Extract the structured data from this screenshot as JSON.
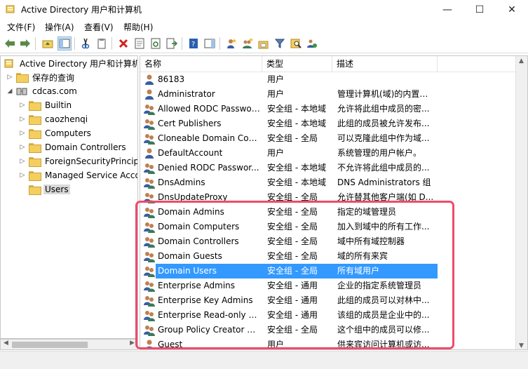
{
  "window": {
    "title": "Active Directory 用户和计算机",
    "minimize": "—",
    "maximize": "☐",
    "close": "✕"
  },
  "menu": [
    "文件(F)",
    "操作(A)",
    "查看(V)",
    "帮助(H)"
  ],
  "tree": {
    "root": "Active Directory 用户和计算机",
    "saved_queries": "保存的查询",
    "domain": "cdcas.com",
    "children": [
      "Builtin",
      "caozhenqi",
      "Computers",
      "Domain Controllers",
      "ForeignSecurityPrincipals",
      "Managed Service Accounts",
      "Users"
    ]
  },
  "list": {
    "columns": [
      "名称",
      "类型",
      "描述"
    ],
    "rows": [
      {
        "name": "86183",
        "type": "用户",
        "desc": "",
        "icon": "user"
      },
      {
        "name": "Administrator",
        "type": "用户",
        "desc": "管理计算机(域)的内置帐...",
        "icon": "user"
      },
      {
        "name": "Allowed RODC Passwor...",
        "type": "安全组 - 本地域",
        "desc": "允许将此组中成员的密...",
        "icon": "group"
      },
      {
        "name": "Cert Publishers",
        "type": "安全组 - 本地域",
        "desc": "此组的成员被允许发布...",
        "icon": "group"
      },
      {
        "name": "Cloneable Domain Cont...",
        "type": "安全组 - 全局",
        "desc": "可以克隆此组中作为域...",
        "icon": "group"
      },
      {
        "name": "DefaultAccount",
        "type": "用户",
        "desc": "系统管理的用户帐户。",
        "icon": "user"
      },
      {
        "name": "Denied RODC Passwor...",
        "type": "安全组 - 本地域",
        "desc": "不允许将此组中成员的...",
        "icon": "group"
      },
      {
        "name": "DnsAdmins",
        "type": "安全组 - 本地域",
        "desc": "DNS Administrators 组",
        "icon": "group"
      },
      {
        "name": "DnsUpdateProxy",
        "type": "安全组 - 全局",
        "desc": "允许替其他客户端(如 D...",
        "icon": "group"
      },
      {
        "name": "Domain Admins",
        "type": "安全组 - 全局",
        "desc": "指定的域管理员",
        "icon": "group"
      },
      {
        "name": "Domain Computers",
        "type": "安全组 - 全局",
        "desc": "加入到域中的所有工作...",
        "icon": "group"
      },
      {
        "name": "Domain Controllers",
        "type": "安全组 - 全局",
        "desc": "域中所有域控制器",
        "icon": "group"
      },
      {
        "name": "Domain Guests",
        "type": "安全组 - 全局",
        "desc": "域的所有来宾",
        "icon": "group"
      },
      {
        "name": "Domain Users",
        "type": "安全组 - 全局",
        "desc": "所有域用户",
        "icon": "group",
        "selected": true
      },
      {
        "name": "Enterprise Admins",
        "type": "安全组 - 通用",
        "desc": "企业的指定系统管理员",
        "icon": "group"
      },
      {
        "name": "Enterprise Key Admins",
        "type": "安全组 - 通用",
        "desc": "此组的成员可以对林中...",
        "icon": "group"
      },
      {
        "name": "Enterprise Read-only D...",
        "type": "安全组 - 通用",
        "desc": "该组的成员是企业中的...",
        "icon": "group"
      },
      {
        "name": "Group Policy Creator O...",
        "type": "安全组 - 全局",
        "desc": "这个组中的成员可以修...",
        "icon": "group"
      },
      {
        "name": "Guest",
        "type": "用户",
        "desc": "供来宾访问计算机或访...",
        "icon": "user"
      }
    ]
  },
  "colors": {
    "selection": "#3399ff",
    "annotation": "#ee4b6a"
  }
}
